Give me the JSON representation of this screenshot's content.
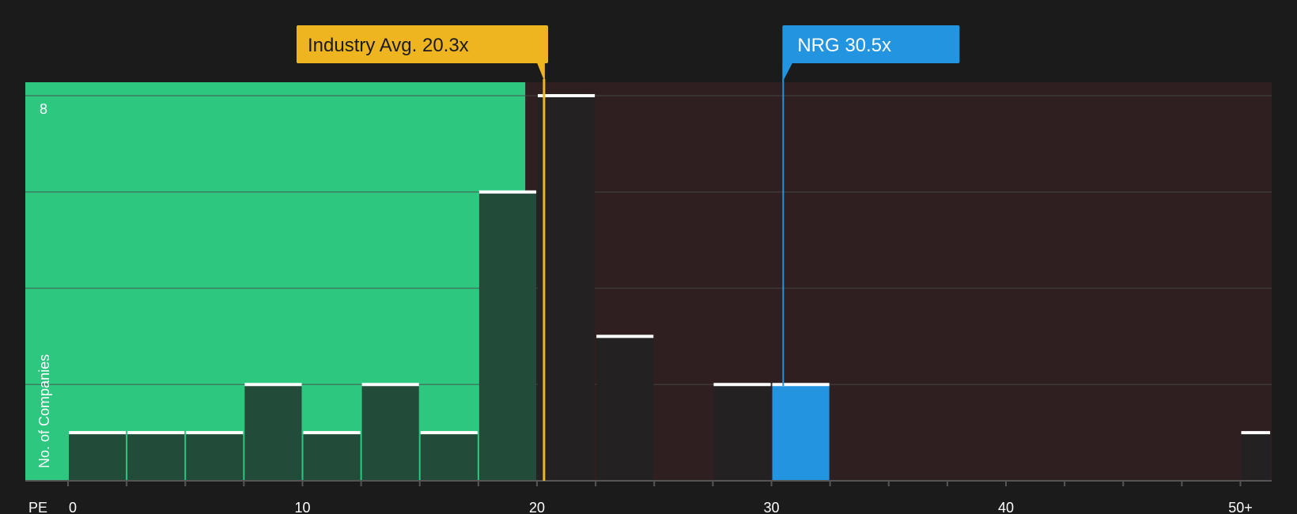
{
  "chart_data": {
    "type": "bar",
    "xlabel": "PE",
    "ylabel": "No. of Companies",
    "xlim": [
      0,
      51.3
    ],
    "ylim": [
      0,
      8.3
    ],
    "x_ticks": [
      "0",
      "10",
      "20",
      "30",
      "40",
      "50+"
    ],
    "y_ticks": [
      "8"
    ],
    "bins": [
      {
        "x0": 0.0,
        "x1": 2.5,
        "count": 1
      },
      {
        "x0": 2.5,
        "x1": 5.0,
        "count": 1
      },
      {
        "x0": 5.0,
        "x1": 7.5,
        "count": 1
      },
      {
        "x0": 7.5,
        "x1": 10.0,
        "count": 2
      },
      {
        "x0": 10.0,
        "x1": 12.5,
        "count": 1
      },
      {
        "x0": 12.5,
        "x1": 15.0,
        "count": 2
      },
      {
        "x0": 15.0,
        "x1": 17.5,
        "count": 1
      },
      {
        "x0": 17.5,
        "x1": 20.0,
        "count": 6
      },
      {
        "x0": 20.0,
        "x1": 22.5,
        "count": 8
      },
      {
        "x0": 22.5,
        "x1": 25.0,
        "count": 3
      },
      {
        "x0": 27.5,
        "x1": 30.0,
        "count": 2
      },
      {
        "x0": 30.0,
        "x1": 32.5,
        "count": 2,
        "highlight": true
      },
      {
        "x0": 50.0,
        "x1": 51.3,
        "count": 1
      }
    ],
    "industry_avg": {
      "value": 20.3,
      "label": "Industry Avg. 20.3x"
    },
    "company": {
      "value": 30.5,
      "label": "NRG 30.5x"
    },
    "zones": {
      "fair_until": 19.5
    },
    "colors": {
      "background": "#1b1b1b",
      "fair_zone": "#2ec780",
      "over_zone": "#2f1f20",
      "bar_in_green": "#224b39",
      "bar_dark": "#242122",
      "highlight_bar": "#2394df",
      "bar_cap": "#ffffff",
      "industry": "#eeb521",
      "company": "#2394df",
      "gridline": "#4a4a4a",
      "axis": "#555555",
      "text": "#ffffff"
    }
  }
}
